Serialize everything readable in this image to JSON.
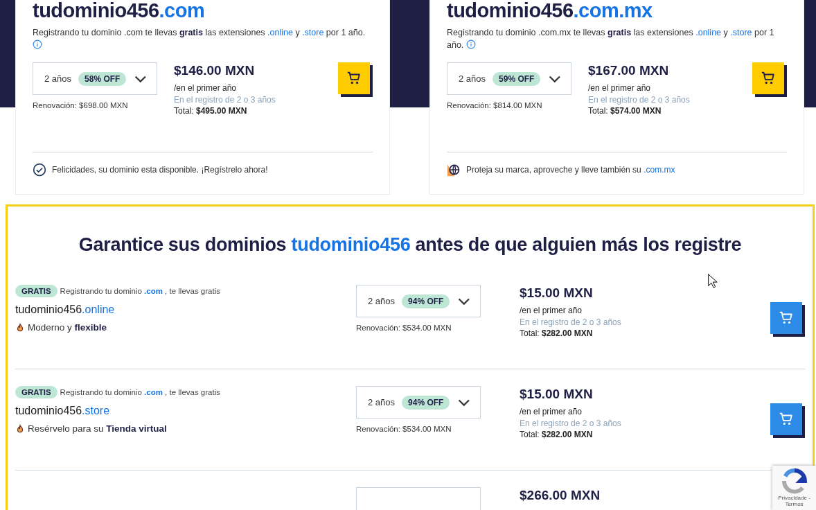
{
  "domain_cards": [
    {
      "name": "tudominio456",
      "extension": ".com",
      "description": [
        {
          "kind": "plain",
          "text": "Registrando tu dominio .com te llevas "
        },
        {
          "kind": "bold",
          "text": "gratis"
        },
        {
          "kind": "plain",
          "text": " las extensiones "
        },
        {
          "kind": "link",
          "text": ".online"
        },
        {
          "kind": "plain",
          "text": " y "
        },
        {
          "kind": "link",
          "text": ".store"
        },
        {
          "kind": "plain",
          "text": " por 1 año."
        }
      ],
      "years": "2 años",
      "discount": "58% OFF",
      "renewal": "Renovación: $698.00 MXN",
      "price": "$146.00 MXN",
      "price_note": "/en el primer año",
      "term_note": "En el registro de 2 o 3 años",
      "total_label": "Total:",
      "total": "$495.00 MXN",
      "notice": {
        "kind": "check",
        "parts": [
          {
            "kind": "plain",
            "text": "Felicidades, su dominio esta disponible. ¡Regístrelo ahora!"
          }
        ]
      }
    },
    {
      "name": "tudominio456",
      "extension": ".com.mx",
      "description": [
        {
          "kind": "plain",
          "text": "Registrando tu dominio .com.mx te llevas "
        },
        {
          "kind": "bold",
          "text": "gratis"
        },
        {
          "kind": "plain",
          "text": " las extensiones "
        },
        {
          "kind": "link",
          "text": ".online"
        },
        {
          "kind": "plain",
          "text": " y "
        },
        {
          "kind": "link",
          "text": ".store"
        },
        {
          "kind": "plain",
          "text": " por 1 año."
        }
      ],
      "years": "2 años",
      "discount": "59% OFF",
      "renewal": "Renovación: $814.00 MXN",
      "price": "$167.00 MXN",
      "price_note": "/en el primer año",
      "term_note": "En el registro de 2 o 3 años",
      "total_label": "Total:",
      "total": "$574.00 MXN",
      "notice": {
        "kind": "globe",
        "parts": [
          {
            "kind": "plain",
            "text": "Proteja su marca, aproveche y lleve también su "
          },
          {
            "kind": "link",
            "text": ".com.mx"
          }
        ]
      }
    }
  ],
  "offer_section": {
    "heading": [
      {
        "kind": "plain",
        "text": "Garantice sus dominios "
      },
      {
        "kind": "accent",
        "text": "tudominio456"
      },
      {
        "kind": "plain",
        "text": " antes de que alguien más los registre"
      }
    ],
    "rows": [
      {
        "badge": "GRATIS",
        "note": [
          {
            "kind": "plain",
            "text": "Registrando tu dominio "
          },
          {
            "kind": "accent",
            "text": ".com"
          },
          {
            "kind": "plain",
            "text": " , te llevas gratis"
          }
        ],
        "name": "tudominio456",
        "extension": ".online",
        "feature": "Moderno y **flexible**",
        "years": "2 años",
        "discount": "94% OFF",
        "renewal": "Renovación: $534.00 MXN",
        "price": "$15.00 MXN",
        "price_note": "/en el primer año",
        "term_note": "En el registro de 2 o 3 años",
        "total_label": "Total:",
        "total": "$282.00 MXN"
      },
      {
        "badge": "GRATIS",
        "note": [
          {
            "kind": "plain",
            "text": "Registrando tu dominio "
          },
          {
            "kind": "accent",
            "text": ".com"
          },
          {
            "kind": "plain",
            "text": " , te llevas gratis"
          }
        ],
        "name": "tudominio456",
        "extension": ".store",
        "feature": "Resérvelo para su **Tienda virtual**",
        "years": "2 años",
        "discount": "94% OFF",
        "renewal": "Renovación: $534.00 MXN",
        "price": "$15.00 MXN",
        "price_note": "/en el primer año",
        "term_note": "En el registro de 2 o 3 años",
        "total_label": "Total:",
        "total": "$282.00 MXN"
      },
      {
        "price": "$266.00 MXN"
      }
    ]
  },
  "recaptcha": {
    "text": "Privacidade - Termos"
  }
}
